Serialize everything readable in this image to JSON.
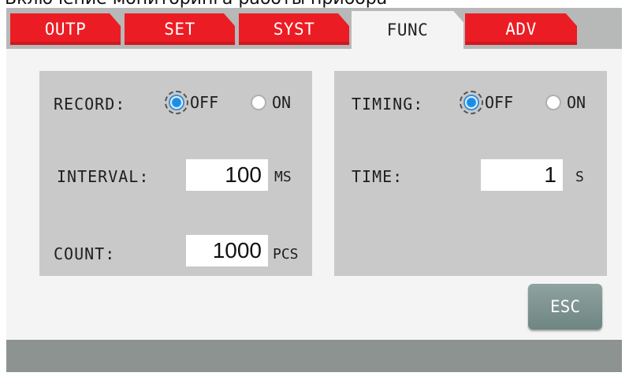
{
  "caption": "Включение мониторинга работы прибора",
  "tabs": [
    {
      "label": "OUTP",
      "active": false
    },
    {
      "label": "SET",
      "active": false
    },
    {
      "label": "SYST",
      "active": false
    },
    {
      "label": "FUNC",
      "active": true
    },
    {
      "label": "ADV",
      "active": false
    }
  ],
  "record_panel": {
    "record_label": "RECORD:",
    "off_label": "OFF",
    "on_label": "ON",
    "selected": "OFF",
    "interval_label": "INTERVAL:",
    "interval_value": "100",
    "interval_unit": "MS",
    "count_label": "COUNT:",
    "count_value": "1000",
    "count_unit": "PCS"
  },
  "timing_panel": {
    "timing_label": "TIMING:",
    "off_label": "OFF",
    "on_label": "ON",
    "selected": "OFF",
    "time_label": "TIME:",
    "time_value": "1",
    "time_unit": "S"
  },
  "esc_label": "ESC",
  "colors": {
    "tab_red": "#ec1c24",
    "tab_bar": "#b7b8b8",
    "panel_gray": "#c9c9c9",
    "radio_selected": "#1a8de6",
    "esc_button": "#7a8f8c",
    "status_bar": "#8d9391"
  }
}
